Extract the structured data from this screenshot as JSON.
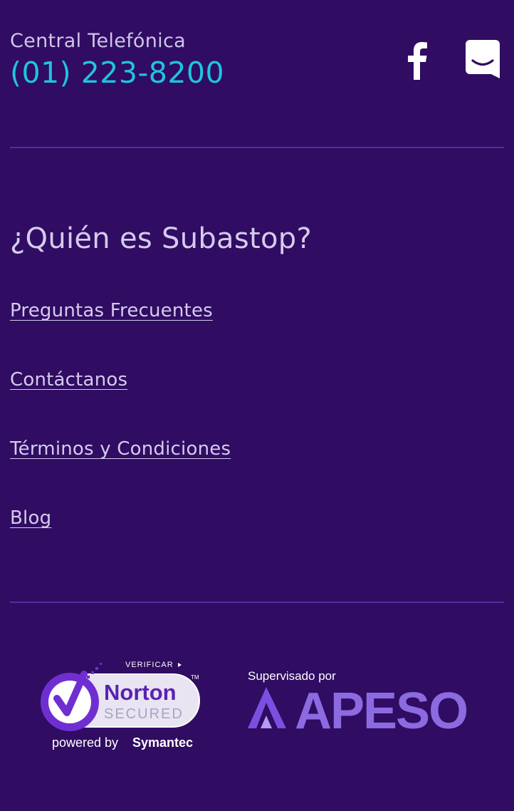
{
  "contact": {
    "label": "Central Telefónica",
    "phone": "(01) 223-8200"
  },
  "social": {
    "facebook_icon": "facebook-icon",
    "chat_icon": "chat-icon"
  },
  "about": {
    "title": "¿Quién es Subastop?"
  },
  "links": [
    {
      "label": "Preguntas Frecuentes"
    },
    {
      "label": "Contáctanos"
    },
    {
      "label": "Términos y Condiciones"
    },
    {
      "label": "Blog"
    }
  ],
  "badges": {
    "norton": {
      "verify": "VERIFICAR",
      "brand": "Norton",
      "secured": "SECURED",
      "powered_prefix": "powered by",
      "powered_brand": "Symantec",
      "tm": "TM"
    },
    "apeso": {
      "caption": "Supervisado por",
      "brand": "APESO"
    }
  },
  "colors": {
    "background": "#300c62",
    "accent_phone": "#1fc4e0",
    "text": "#d5cbed",
    "divider": "#5a2ba4",
    "apeso_purple": "#8c6ae0",
    "norton_purple": "#6f2fd0"
  }
}
